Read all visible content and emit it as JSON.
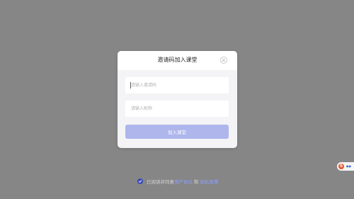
{
  "dialog": {
    "title": "邀请码加入课堂",
    "invite_code_placeholder": "请输入邀请码",
    "name_placeholder": "请输入昵称",
    "join_button_label": "加入课堂"
  },
  "agreement": {
    "prefix": "已阅读并同意",
    "user_agreement": "用户协议",
    "and": "和",
    "privacy_policy": "隐私政策"
  },
  "colors": {
    "overlay": "#7d7d7d",
    "accent": "#3b4bb8",
    "button_disabled": "#aeb6ec",
    "link": "#8da0ff"
  }
}
